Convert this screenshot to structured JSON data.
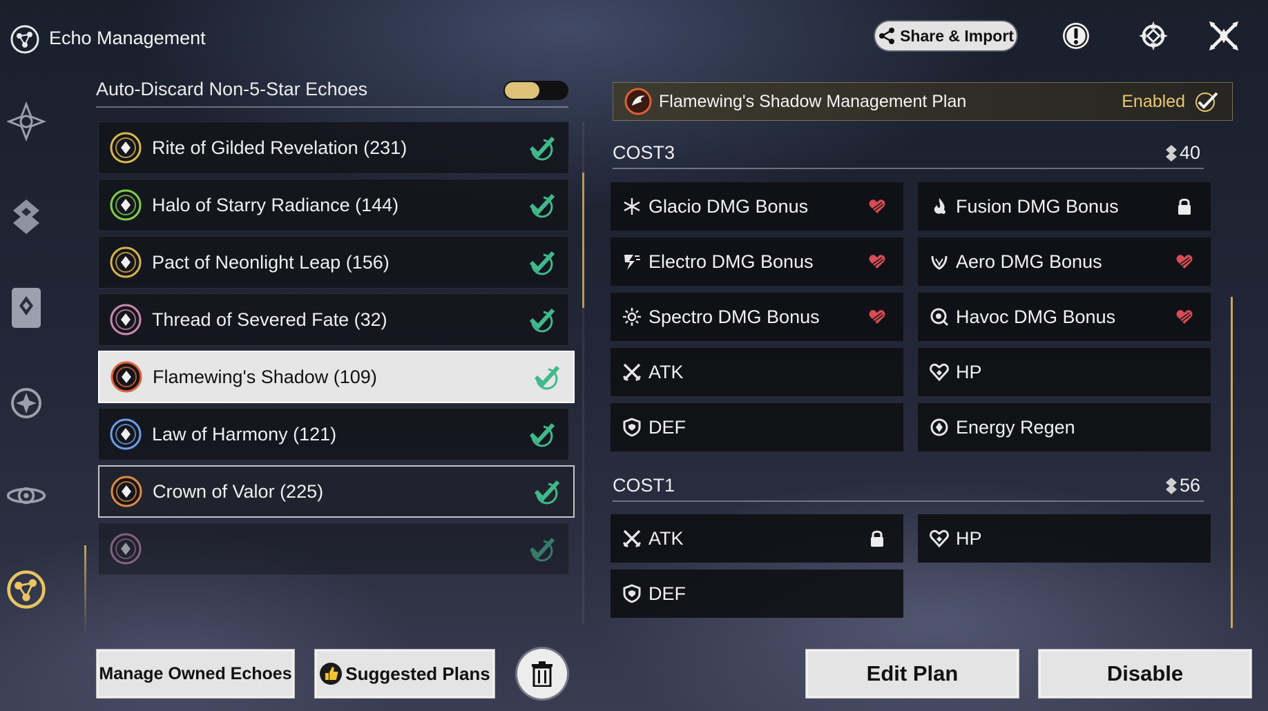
{
  "header": {
    "title": "Echo Management",
    "share_import_label": "Share & Import",
    "icons": [
      "echo-logo-icon",
      "share-icon",
      "alert-icon",
      "resonance-icon",
      "close-icon"
    ]
  },
  "sidebar": {
    "items": [
      "resonator-icon",
      "weapon-icon",
      "echo-card-icon",
      "sonata-icon",
      "tuner-icon",
      "echo-management-icon"
    ],
    "active": "echo-management-icon"
  },
  "auto_discard": {
    "label": "Auto-Discard Non-5-Star Echoes",
    "enabled": true
  },
  "sets": [
    {
      "name": "Rite of Gilded Revelation (231)",
      "color": "#d9b84c",
      "checked": true
    },
    {
      "name": "Halo of Starry Radiance (144)",
      "color": "#7fcf4a",
      "checked": true
    },
    {
      "name": "Pact of Neonlight Leap (156)",
      "color": "#d8b24a",
      "checked": true
    },
    {
      "name": "Thread of Severed Fate (32)",
      "color": "#c98ab0",
      "checked": true
    },
    {
      "name": "Flamewing's Shadow (109)",
      "color": "#e0603a",
      "checked": true,
      "selected": true
    },
    {
      "name": "Law of Harmony (121)",
      "color": "#6aa0e8",
      "checked": true
    },
    {
      "name": "Crown of Valor (225)",
      "color": "#e08a40",
      "checked": true,
      "highlighted": true
    },
    {
      "name": "",
      "color": "#c98ab0",
      "checked": true
    }
  ],
  "plan": {
    "title": "Flamewing's Shadow Management Plan",
    "status": "Enabled",
    "accent": "#e8c873"
  },
  "cost3": {
    "title": "COST3",
    "count": "40",
    "stats": [
      {
        "name": "Glacio DMG Bonus",
        "icon": "glacio-icon",
        "badge": "heart-icon"
      },
      {
        "name": "Fusion DMG Bonus",
        "icon": "fusion-icon",
        "badge": "lock-icon"
      },
      {
        "name": "Electro DMG Bonus",
        "icon": "electro-icon",
        "badge": "heart-icon"
      },
      {
        "name": "Aero DMG Bonus",
        "icon": "aero-icon",
        "badge": "heart-icon"
      },
      {
        "name": "Spectro DMG Bonus",
        "icon": "spectro-icon",
        "badge": "heart-icon"
      },
      {
        "name": "Havoc DMG Bonus",
        "icon": "havoc-icon",
        "badge": "heart-icon"
      },
      {
        "name": "ATK",
        "icon": "atk-icon",
        "badge": ""
      },
      {
        "name": "HP",
        "icon": "hp-icon",
        "badge": ""
      },
      {
        "name": "DEF",
        "icon": "def-icon",
        "badge": ""
      },
      {
        "name": "Energy Regen",
        "icon": "energy-regen-icon",
        "badge": ""
      }
    ]
  },
  "cost1": {
    "title": "COST1",
    "count": "56",
    "stats": [
      {
        "name": "ATK",
        "icon": "atk-icon",
        "badge": "lock-icon"
      },
      {
        "name": "HP",
        "icon": "hp-icon",
        "badge": ""
      },
      {
        "name": "DEF",
        "icon": "def-icon",
        "badge": ""
      }
    ]
  },
  "buttons": {
    "manage_owned": "Manage Owned Echoes",
    "suggested_plans": "Suggested Plans",
    "edit_plan": "Edit Plan",
    "disable": "Disable"
  },
  "colors": {
    "heart": "#e0505a",
    "check": "#3fb98a",
    "gold": "#c9a75a"
  }
}
